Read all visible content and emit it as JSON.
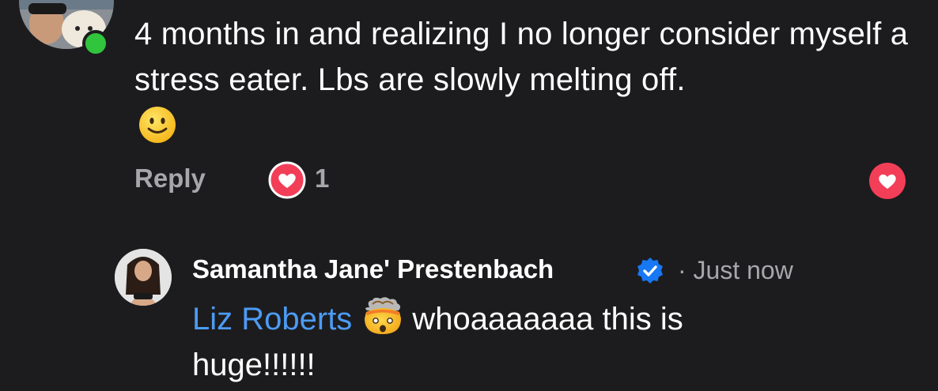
{
  "comment": {
    "text": "4 months in and realizing I no longer consider myself a stress eater. Lbs are slowly melting off.",
    "emoji": "slightly-smiling-face",
    "reply_label": "Reply",
    "reaction_count": "1",
    "online": true
  },
  "reply": {
    "author": "Samantha Jane' Prestenbach",
    "verified": true,
    "time": "· Just now",
    "mention": "Liz Roberts",
    "emoji": "exploding-head",
    "text_line1": "whoaaaaaaa this is",
    "text_line2": "huge!!!!!!"
  },
  "colors": {
    "background": "#1c1c1e",
    "text": "#ffffff",
    "secondary_text": "#a7a7ab",
    "mention": "#4c9bf4",
    "heart_red": "#f33e58",
    "online_green": "#31c43d",
    "verified_blue": "#1877f2"
  }
}
